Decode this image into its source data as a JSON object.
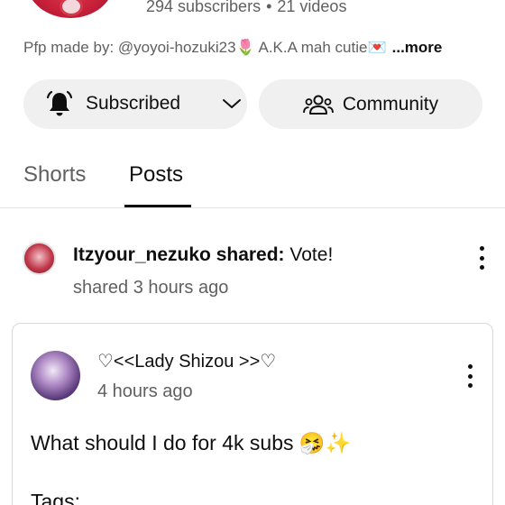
{
  "channel": {
    "subscribers": "294 subscribers",
    "separator": "•",
    "videos": "21 videos",
    "description": "Pfp made by: @yoyoi-hozuki23🌷 A.K.A mah cutie💌",
    "more_label": "...more"
  },
  "actions": {
    "subscribed_label": "Subscribed",
    "community_label": "Community"
  },
  "tabs": [
    {
      "label": "Shorts",
      "active": false
    },
    {
      "label": "Posts",
      "active": true
    }
  ],
  "shared_post": {
    "sharer_name": "Itzyour_nezuko shared:",
    "shared_title": "Vote!",
    "shared_time": "shared 3 hours ago",
    "original": {
      "author": "♡<<Lady Shizou >>♡",
      "time": "4 hours ago",
      "body": "What should I do for 4k subs 🤧✨",
      "tags_label": "Tags:"
    }
  },
  "icons": {
    "bell": "bell-icon",
    "chevron": "chevron-down-icon",
    "community": "people-icon",
    "menu": "more-vert-icon"
  }
}
